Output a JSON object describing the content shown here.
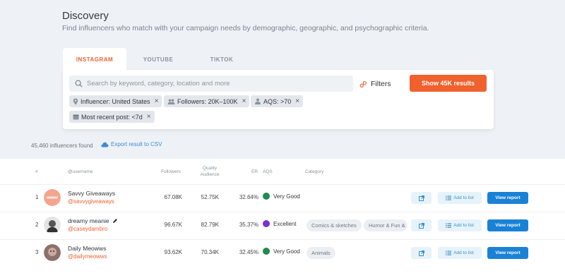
{
  "header": {
    "title": "Discovery",
    "subtitle": "Find influencers who match with your campaign needs by demographic, geographic, and psychographic criteria."
  },
  "tabs": [
    {
      "label": "INSTAGRAM",
      "active": true
    },
    {
      "label": "YOUTUBE",
      "active": false
    },
    {
      "label": "TIKTOK",
      "active": false
    }
  ],
  "search": {
    "placeholder": "Search by keyword, category, location and more",
    "value": ""
  },
  "filters_label": "Filters",
  "show_results_label": "Show 45K results",
  "chips": [
    {
      "label": "Influencer: United States",
      "icon": "location-pin-icon"
    },
    {
      "label": "Followers: 20K–100K",
      "icon": "people-icon"
    },
    {
      "label": "AQS: >70",
      "icon": "audience-icon"
    },
    {
      "label": "Most recent post: <7d",
      "icon": "calendar-icon"
    }
  ],
  "summary": {
    "count_text": "45,460 influencers found",
    "export_label": "Export result to CSV"
  },
  "table": {
    "headers": {
      "num": "#",
      "username": "@username",
      "followers": "Followers",
      "quality_audience": "Quality Audience",
      "er": "ER",
      "aqs": "AQS",
      "category": "Category"
    },
    "rows": [
      {
        "num": "1",
        "name": "Savvy Giveaways",
        "handle": "@savvygiveaways",
        "followers": "67.08K",
        "quality_audience": "52.75K",
        "er": "32.64%",
        "aqs_label": "Very Good",
        "aqs_color": "#1f8a4c",
        "categories": [],
        "avatar_color": "#f5a48e"
      },
      {
        "num": "2",
        "name": "dreamy meanie",
        "handle": "@caseydambro",
        "followers": "96.67K",
        "quality_audience": "82.79K",
        "er": "35.37%",
        "aqs_label": "Excellent",
        "aqs_color": "#7b32d1",
        "categories": [
          "Comics & sketches",
          "Humor & Fun &"
        ],
        "avatar_color": "#d9d9d9"
      },
      {
        "num": "3",
        "name": "Daily Meowws",
        "handle": "@dailymeowws",
        "followers": "93.62K",
        "quality_audience": "70.34K",
        "er": "32.45%",
        "aqs_label": "Very Good",
        "aqs_color": "#1f8a4c",
        "categories": [
          "Animals"
        ],
        "avatar_color": "#8e6f6a"
      }
    ],
    "add_to_list_label": "Add to list",
    "view_report_label": "View report"
  },
  "colors": {
    "accent": "#f0612e",
    "primary_blue": "#1a82d6",
    "background": "#eef1f5"
  }
}
